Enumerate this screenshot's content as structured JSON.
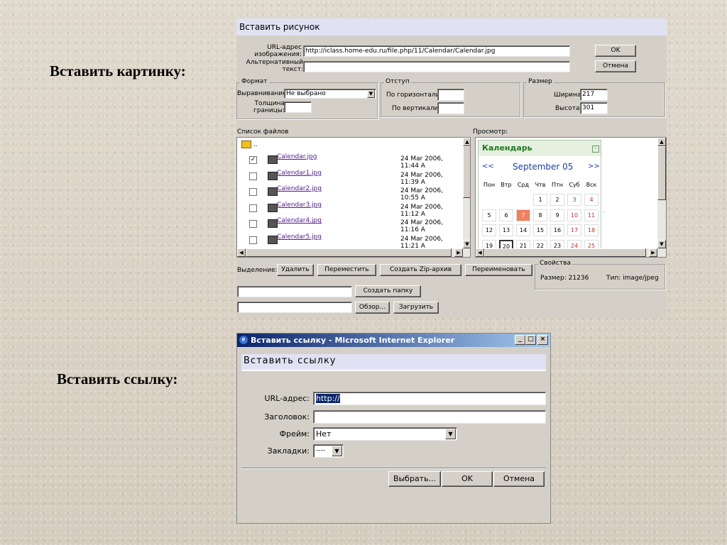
{
  "slide": {
    "label_image": "Вставить картинку:",
    "label_link": "Вставить ссылку:"
  },
  "image_dialog": {
    "title": "Вставить рисунок",
    "url_label": "URL-адрес изображения:",
    "url_value": "http://iclass.home-edu.ru/file.php/11/Calendar/Calendar.jpg",
    "alt_label": "Альтернативный текст:",
    "alt_value": "",
    "ok": "OK",
    "cancel": "Отмена",
    "format": {
      "legend": "Формат",
      "align_label": "Выравнивание:",
      "align_value": "Не выбрано",
      "border_label": "Толщина границы:",
      "border_value": ""
    },
    "spacing": {
      "legend": "Отступ",
      "h_label": "По горизонтали:",
      "h_value": "",
      "v_label": "По вертикали:",
      "v_value": ""
    },
    "size": {
      "legend": "Размер",
      "width_label": "Ширина:",
      "width_value": "217",
      "height_label": "Высота:",
      "height_value": "301"
    },
    "file_list_label": "Список файлов",
    "up_dir": "..",
    "files": [
      {
        "name": "Calendar.jpg",
        "date": "24 Mar 2006, 11:44 A",
        "checked": true
      },
      {
        "name": "Calendar1.jpg",
        "date": "24 Mar 2006, 11:39 A",
        "checked": false
      },
      {
        "name": "Calendar2.jpg",
        "date": "24 Mar 2006, 10:55 A",
        "checked": false
      },
      {
        "name": "Calendar3.jpg",
        "date": "24 Mar 2006, 11:12 A",
        "checked": false
      },
      {
        "name": "Calendar4.jpg",
        "date": "24 Mar 2006, 11:16 A",
        "checked": false
      },
      {
        "name": "Calendar5.jpg",
        "date": "24 Mar 2006, 11:21 A",
        "checked": false
      }
    ],
    "preview_label": "Просмотр:",
    "calendar": {
      "title": "Календарь",
      "prev": "<<",
      "month": "September 05",
      "next": ">>",
      "weekdays": [
        "Пон",
        "Втр",
        "Срд",
        "Чтв",
        "Птн",
        "Суб",
        "Вск"
      ],
      "weeks": [
        [
          "",
          "",
          "",
          "1",
          "2",
          "3",
          "4"
        ],
        [
          "5",
          "6",
          "7",
          "8",
          "9",
          "10",
          "11"
        ],
        [
          "12",
          "13",
          "14",
          "15",
          "16",
          "17",
          "18"
        ],
        [
          "19",
          "20",
          "21",
          "22",
          "23",
          "24",
          "25"
        ]
      ],
      "highlight_day": "7",
      "selected_day": "20"
    },
    "selection_label": "Выделение:",
    "delete": "Удалить",
    "move": "Переместить",
    "zip": "Создать Zip-архив",
    "rename": "Переименовать",
    "props": {
      "legend": "Свойства",
      "size_text": "Размер: 21236",
      "type_text": "Тип: image/jpeg"
    },
    "folder_value": "",
    "create_folder": "Создать папку",
    "upload_value": "",
    "browse": "Обзор...",
    "upload": "Загрузить"
  },
  "link_dialog": {
    "window_title": "Вставить ссылку - Microsoft Internet Explorer",
    "heading": "Вставить ссылку",
    "url_label": "URL-адрес:",
    "url_value": "http://",
    "caption_label": "Заголовок:",
    "caption_value": "",
    "frame_label": "Фрейм:",
    "frame_value": "Нет",
    "bookmark_label": "Закладки:",
    "bookmark_value": "----",
    "browse": "Выбрать...",
    "ok": "OK",
    "cancel": "Отмена"
  },
  "colors": {
    "title_bg": "#e0e2f4",
    "calendar_green": "#1e7a1e",
    "highlight": "#f08060",
    "weekend": "#c03030",
    "link": "#551a8b"
  }
}
